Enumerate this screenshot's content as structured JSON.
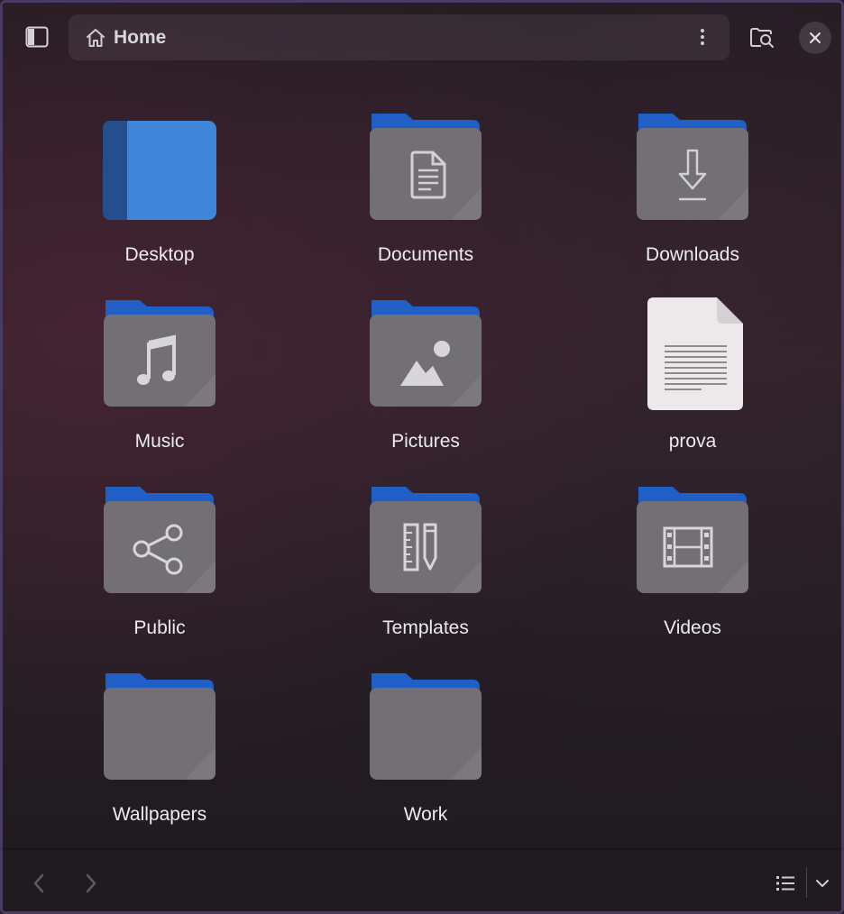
{
  "header": {
    "path_label": "Home"
  },
  "colors": {
    "folder_tab": "#1f63c9",
    "folder_body": "#6f6b70",
    "desktop_blue": "#3a7fd4",
    "accent_border": "#4a3a66"
  },
  "items": [
    {
      "label": "Desktop",
      "icon": "desktop-folder-icon"
    },
    {
      "label": "Documents",
      "icon": "documents-folder-icon"
    },
    {
      "label": "Downloads",
      "icon": "downloads-folder-icon"
    },
    {
      "label": "Music",
      "icon": "music-folder-icon"
    },
    {
      "label": "Pictures",
      "icon": "pictures-folder-icon"
    },
    {
      "label": "prova",
      "icon": "text-file-icon"
    },
    {
      "label": "Public",
      "icon": "public-folder-icon"
    },
    {
      "label": "Templates",
      "icon": "templates-folder-icon"
    },
    {
      "label": "Videos",
      "icon": "videos-folder-icon"
    },
    {
      "label": "Wallpapers",
      "icon": "folder-icon"
    },
    {
      "label": "Work",
      "icon": "folder-icon"
    }
  ]
}
